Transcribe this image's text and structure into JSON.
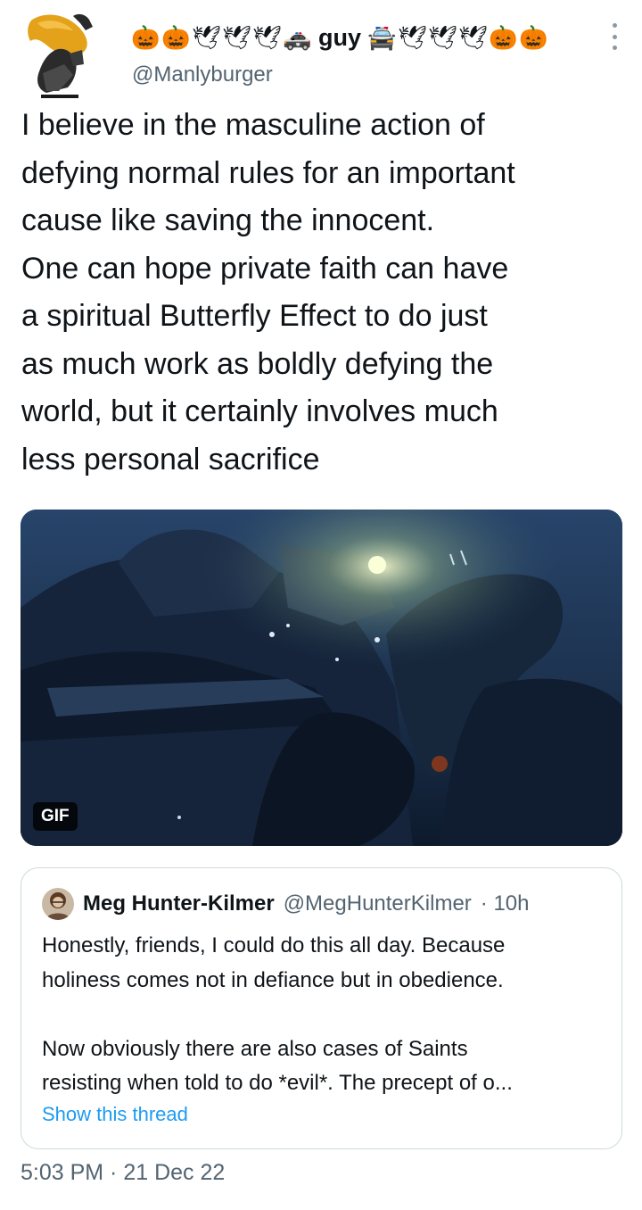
{
  "author": {
    "display_name": "guy",
    "emoji_left": [
      "🎃",
      "🎃",
      "🕊",
      "🕊",
      "🕊",
      "🚓"
    ],
    "emoji_right": [
      "🚔",
      "🕊",
      "🕊",
      "🕊",
      "🎃",
      "🎃"
    ],
    "handle": "@Manlyburger"
  },
  "tweet": {
    "text": "I believe in the masculine action of\ndefying normal rules for an important\ncause like saving the innocent.\nOne can hope private faith can have\na spiritual Butterfly Effect to do just\nas much work as boldly defying the\nworld, but it certainly involves much\nless personal sacrifice"
  },
  "media": {
    "badge": "GIF"
  },
  "quoted_tweet": {
    "name": "Meg Hunter-Kilmer",
    "handle": "@MegHunterKilmer",
    "time": "· 10h",
    "lines": [
      "Honestly, friends, I could do this all day. Because",
      "holiness comes not in defiance but in obedience.",
      "",
      "Now obviously there are also cases of Saints",
      "resisting when told to do *evil*. The precept of o..."
    ],
    "show_thread": "Show this thread"
  },
  "timestamp": "5:03 PM · 21 Dec 22"
}
